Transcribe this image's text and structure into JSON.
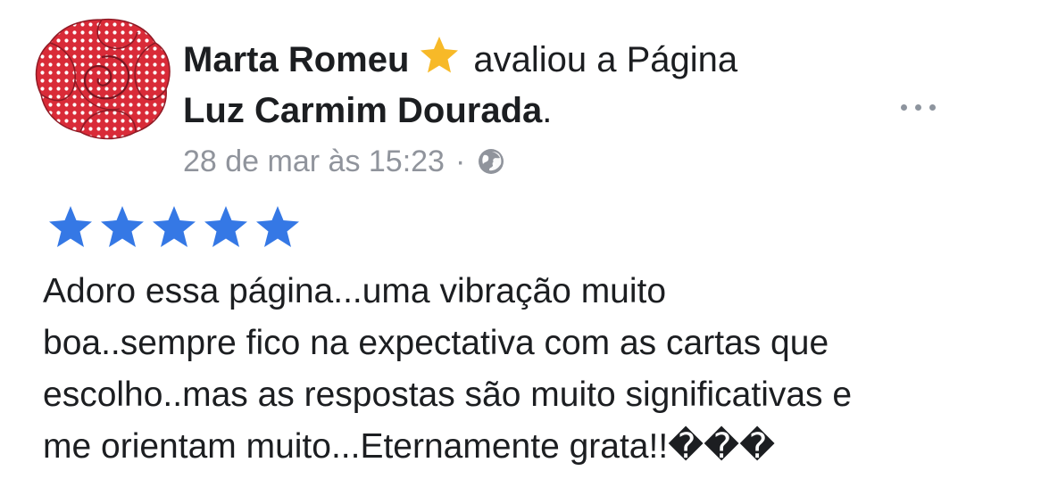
{
  "post": {
    "author": "Marta Romeu",
    "action_text": "avaliou a Página",
    "page_name": "Luz Carmim Dourada",
    "page_name_suffix": ".",
    "timestamp": "28 de mar às 15:23",
    "separator": "·",
    "privacy_icon": "globe-icon",
    "badge_icon": "star-icon",
    "more_icon": "more-options-icon",
    "rating": {
      "stars": 5,
      "max": 5,
      "color": "#3578e5"
    },
    "review_lines": [
      "Adoro essa página...uma vibração muito",
      "boa..sempre fico na expectativa com as cartas que",
      "escolho..mas as respostas são muito significativas e",
      "me orientam muito...Eternamente grata!!���"
    ]
  },
  "colors": {
    "badge_star": "#f7b928",
    "secondary_text": "#90949c",
    "primary_text": "#1c1e21",
    "avatar_rose": "#d92b38"
  }
}
